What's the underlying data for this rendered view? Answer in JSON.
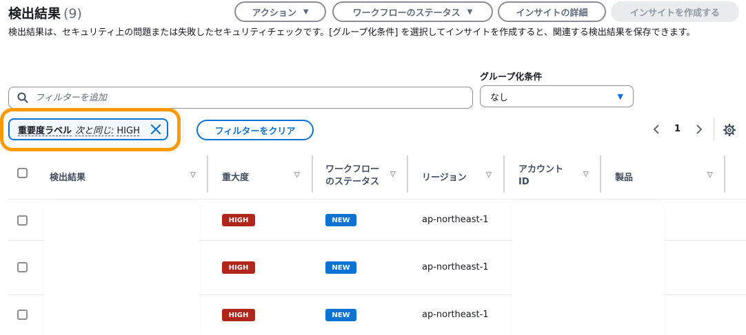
{
  "header": {
    "title": "検出結果",
    "count": "(9)",
    "actions_label": "アクション",
    "workflow_status_label": "ワークフローのステータス",
    "insight_details_label": "インサイトの詳細",
    "create_insight_label": "インサイトを作成する"
  },
  "description": "検出結果は、セキュリティ上の問題または失敗したセキュリティチェックです。[グループ化条件] を選択してインサイトを作成すると、関連する検出結果を保存できます。",
  "filter": {
    "placeholder": "フィルターを追加",
    "group_by_label": "グループ化条件",
    "group_by_value": "なし",
    "token_key": "重要度ラベル",
    "token_operator": "次と同じ:",
    "token_value": "HIGH",
    "clear_label": "フィルターをクリア"
  },
  "pagination": {
    "current_page": "1"
  },
  "table": {
    "columns": [
      "検出結果",
      "重大度",
      "ワークフローのステータス",
      "リージョン",
      "アカウントID",
      "製品"
    ],
    "column_lines": {
      "workflow": [
        "ワークフロー",
        "のステータス"
      ],
      "account": [
        "アカウント",
        "ID"
      ]
    },
    "rows": [
      {
        "severity": "HIGH",
        "workflow": "NEW",
        "region": "ap-northeast-1"
      },
      {
        "severity": "HIGH",
        "workflow": "NEW",
        "region": "ap-northeast-1"
      },
      {
        "severity": "HIGH",
        "workflow": "NEW",
        "region": "ap-northeast-1"
      }
    ]
  },
  "colors": {
    "accent": "#0972d3",
    "highlight": "#ff9900",
    "high_badge": "#b0261a",
    "new_badge": "#0972d3"
  }
}
